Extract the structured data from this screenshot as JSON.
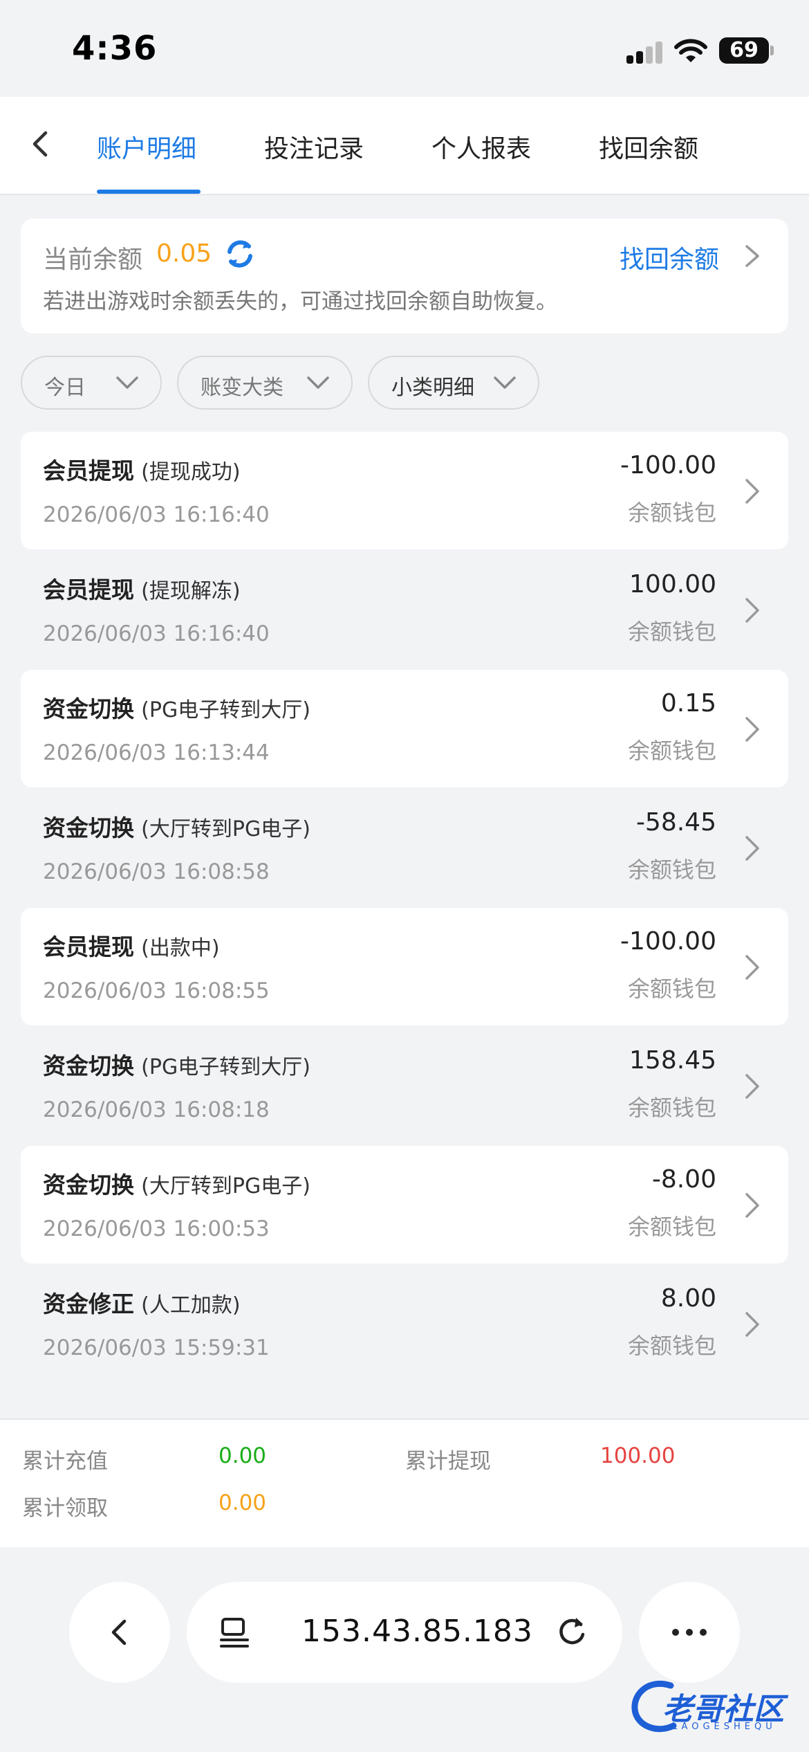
{
  "status_bar": {
    "time": "4:36",
    "battery": "69"
  },
  "tabs": [
    {
      "label": "账户明细",
      "active": true
    },
    {
      "label": "投注记录",
      "active": false
    },
    {
      "label": "个人报表",
      "active": false
    },
    {
      "label": "找回余额",
      "active": false
    }
  ],
  "balance": {
    "label": "当前余额",
    "value": "0.05",
    "link": "找回余额",
    "hint": "若进出游戏时余额丢失的，可通过找回余额自助恢复。"
  },
  "filters": [
    {
      "label": "今日"
    },
    {
      "label": "账变大类"
    },
    {
      "label": "小类明细"
    }
  ],
  "records": [
    {
      "title": "会员提现",
      "sub": "(提现成功)",
      "time": "2026/06/03 16:16:40",
      "amount": "-100.00",
      "wallet": "余额钱包"
    },
    {
      "title": "会员提现",
      "sub": "(提现解冻)",
      "time": "2026/06/03 16:16:40",
      "amount": "100.00",
      "wallet": "余额钱包"
    },
    {
      "title": "资金切换",
      "sub": "(PG电子转到大厅)",
      "time": "2026/06/03 16:13:44",
      "amount": "0.15",
      "wallet": "余额钱包"
    },
    {
      "title": "资金切换",
      "sub": "(大厅转到PG电子)",
      "time": "2026/06/03 16:08:58",
      "amount": "-58.45",
      "wallet": "余额钱包"
    },
    {
      "title": "会员提现",
      "sub": "(出款中)",
      "time": "2026/06/03 16:08:55",
      "amount": "-100.00",
      "wallet": "余额钱包"
    },
    {
      "title": "资金切换",
      "sub": "(PG电子转到大厅)",
      "time": "2026/06/03 16:08:18",
      "amount": "158.45",
      "wallet": "余额钱包"
    },
    {
      "title": "资金切换",
      "sub": "(大厅转到PG电子)",
      "time": "2026/06/03 16:00:53",
      "amount": "-8.00",
      "wallet": "余额钱包"
    },
    {
      "title": "资金修正",
      "sub": "(人工加款)",
      "time": "2026/06/03 15:59:31",
      "amount": "8.00",
      "wallet": "余额钱包"
    }
  ],
  "summary": {
    "recharge_label": "累计充值",
    "recharge_value": "0.00",
    "withdraw_label": "累计提现",
    "withdraw_value": "100.00",
    "claim_label": "累计领取",
    "claim_value": "0.00"
  },
  "browser": {
    "url": "153.43.85.183"
  },
  "watermark": {
    "text": "老哥社区",
    "sub": "LAOGESHEQU"
  },
  "colors": {
    "accent": "#1e7be5",
    "balance": "#f7a21b",
    "recharge": "#1aad19",
    "withdraw": "#e64340",
    "claim": "#f7a21b"
  },
  "icons": [
    "back-icon",
    "refresh-icon",
    "chevron-right-icon",
    "chevron-down-icon",
    "tabs-list-icon",
    "reload-icon",
    "more-icon"
  ]
}
